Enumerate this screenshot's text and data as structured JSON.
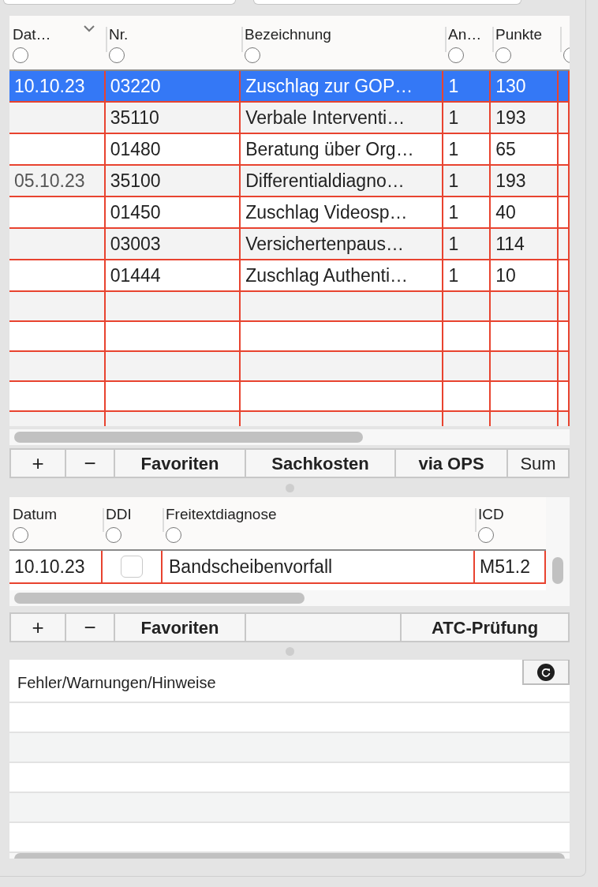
{
  "top_fields": [
    {
      "kind": "field"
    },
    {
      "kind": "field"
    }
  ],
  "services_table": {
    "columns": [
      {
        "label": "Dat…",
        "filter_selected": false
      },
      {
        "label": "Nr.",
        "filter_selected": false
      },
      {
        "label": "Bezeichnung",
        "filter_selected": false
      },
      {
        "label": "An…",
        "filter_selected": false
      },
      {
        "label": "Punkte",
        "filter_selected": false
      },
      {
        "filter_selected": false
      }
    ],
    "rows": [
      {
        "date": "10.10.23",
        "nr": "03220",
        "bezeichnung": "Zuschlag zur GOP…",
        "anzahl": "1",
        "punkte": "130",
        "selected": true
      },
      {
        "date": "",
        "nr": "35110",
        "bezeichnung": "Verbale Interventi…",
        "anzahl": "1",
        "punkte": "193",
        "selected": false
      },
      {
        "date": "",
        "nr": "01480",
        "bezeichnung": "Beratung über Org…",
        "anzahl": "1",
        "punkte": "65",
        "selected": false
      },
      {
        "date": "05.10.23",
        "nr": "35100",
        "bezeichnung": "Differentialdiagno…",
        "anzahl": "1",
        "punkte": "193",
        "selected": false
      },
      {
        "date": "",
        "nr": "01450",
        "bezeichnung": "Zuschlag Videosp…",
        "anzahl": "1",
        "punkte": "40",
        "selected": false
      },
      {
        "date": "",
        "nr": "03003",
        "bezeichnung": "Versichertenpaus…",
        "anzahl": "1",
        "punkte": "114",
        "selected": false
      },
      {
        "date": "",
        "nr": "01444",
        "bezeichnung": "Zuschlag Authenti…",
        "anzahl": "1",
        "punkte": "10",
        "selected": false
      }
    ]
  },
  "services_toolbar": [
    {
      "label": "+",
      "kind": "symbol"
    },
    {
      "label": "−",
      "kind": "symbol"
    },
    {
      "label": "Favoriten",
      "kind": "label"
    },
    {
      "label": "Sachkosten",
      "kind": "label"
    },
    {
      "label": "via OPS",
      "kind": "label"
    },
    {
      "label": "Sum",
      "kind": "plain"
    }
  ],
  "diagnoses_table": {
    "columns": [
      {
        "label": "Datum",
        "filter_selected": false
      },
      {
        "label": "DDI",
        "filter_selected": false
      },
      {
        "label": "Freitextdiagnose",
        "filter_selected": false
      },
      {
        "label": "ICD",
        "filter_selected": false
      }
    ],
    "rows": [
      {
        "date": "10.10.23",
        "ddi_checked": false,
        "text": "Bandscheibenvorfall",
        "icd": "M51.2"
      }
    ]
  },
  "diagnoses_toolbar": [
    {
      "label": "+",
      "kind": "symbol"
    },
    {
      "label": "−",
      "kind": "symbol"
    },
    {
      "label": "Favoriten",
      "kind": "label"
    },
    {
      "kind": "spacer"
    },
    {
      "label": "ATC-Prüfung",
      "kind": "label"
    }
  ],
  "messages": {
    "title": "Fehler/Warnungen/Hinweise"
  }
}
